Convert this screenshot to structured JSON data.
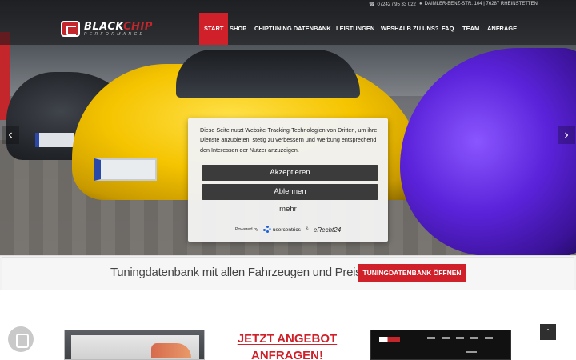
{
  "topbar": {
    "phone_icon": "phone-icon",
    "phone": "07242 / 95 33 022",
    "address_icon": "location-pin-icon",
    "address": "DAIMLER-BENZ-STR. 104 | 76287 RHEINSTETTEN"
  },
  "logo": {
    "main_white": "BLACK",
    "main_red": "CHIP",
    "sub": "PERFORMANCE"
  },
  "nav": {
    "items": [
      {
        "label": "START",
        "active": true
      },
      {
        "label": "SHOP",
        "active": false
      },
      {
        "label": "CHIPTUNING DATENBANK",
        "active": false
      },
      {
        "label": "LEISTUNGEN",
        "active": false
      },
      {
        "label": "WESHALB ZU UNS?",
        "active": false
      },
      {
        "label": "FAQ",
        "active": false
      },
      {
        "label": "TEAM",
        "active": false
      },
      {
        "label": "ANFRAGE",
        "active": false
      }
    ]
  },
  "slider": {
    "prev_icon": "chevron-left-icon",
    "next_icon": "chevron-right-icon",
    "prev_glyph": "‹",
    "next_glyph": "›"
  },
  "consent": {
    "text": "Diese Seite nutzt Website-Tracking-Technologien von Dritten, um ihre Dienste anzubieten, stetig zu verbessern und Werbung entsprechend den Interessen der Nutzer anzuzeigen.",
    "accept_label": "Akzeptieren",
    "decline_label": "Ablehnen",
    "more_label": "mehr",
    "powered_by": "Powered by",
    "usercentrics": "usercentrics",
    "amp": "&",
    "erecht": "eRecht24"
  },
  "tuning": {
    "text": "Tuningdatenbank mit allen Fahrzeugen und Preisen",
    "button_label": "TUNINGDATENBANK ÖFFNEN"
  },
  "offer": {
    "line1": "JETZT ANGEBOT",
    "line2": "ANFRAGEN!"
  },
  "scrolltop_glyph": "⌃",
  "colors": {
    "accent_red": "#d0202a",
    "dark_button": "#3b3b3b"
  }
}
